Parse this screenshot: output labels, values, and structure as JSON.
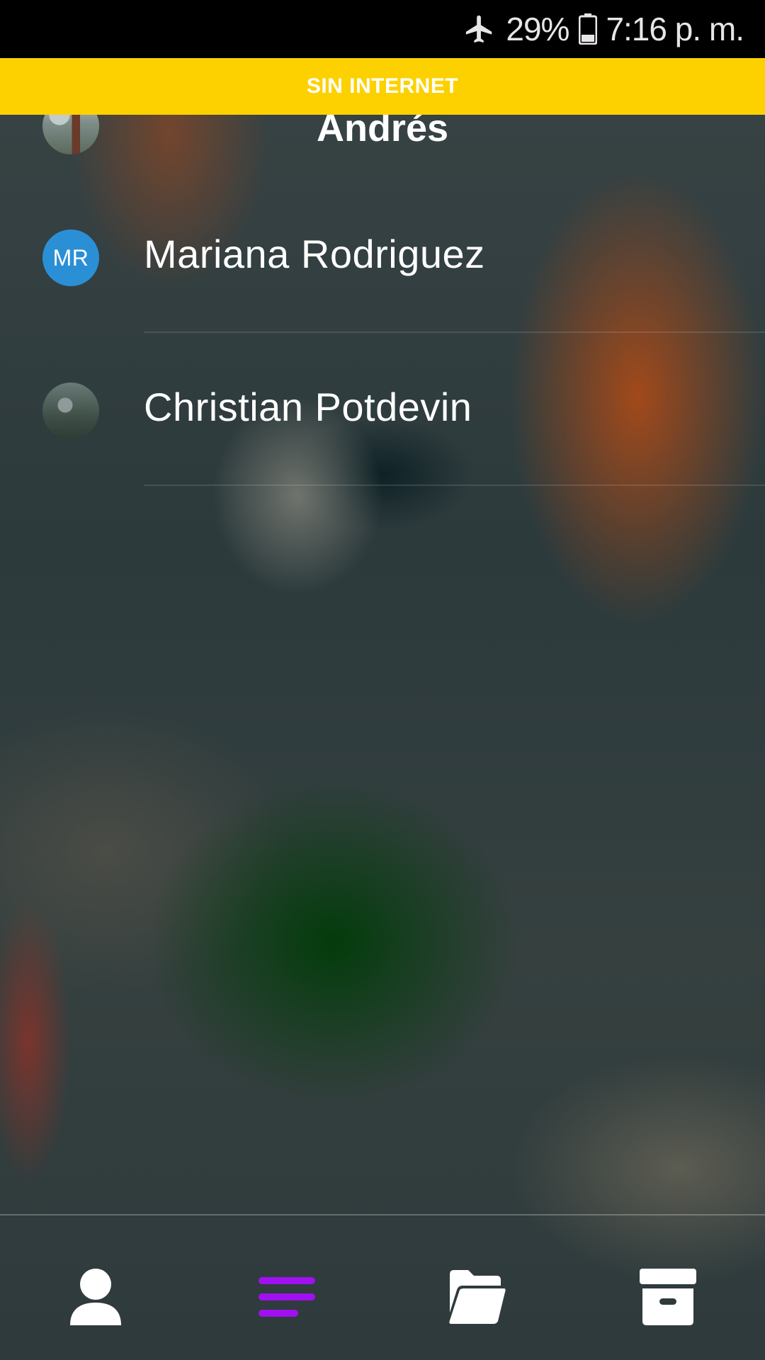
{
  "status_bar": {
    "icons": [
      "airplane-mode-icon",
      "battery-icon"
    ],
    "battery_percent": "29%",
    "time": "7:16 p. m."
  },
  "banner": {
    "text": "SIN INTERNET",
    "color": "#fdd100"
  },
  "contacts": [
    {
      "name": "Andrés",
      "avatar_type": "photo"
    },
    {
      "name": "Mariana Rodriguez",
      "avatar_type": "initials",
      "initials": "MR",
      "avatar_color": "#2b8fd6"
    },
    {
      "name": "Christian Potdevin",
      "avatar_type": "photo"
    }
  ],
  "bottom_nav": {
    "items": [
      {
        "icon": "person-icon",
        "active": false
      },
      {
        "icon": "list-icon",
        "active": true
      },
      {
        "icon": "folder-open-icon",
        "active": false
      },
      {
        "icon": "archive-icon",
        "active": false
      }
    ],
    "active_color": "#a010f0",
    "inactive_color": "#ffffff"
  }
}
